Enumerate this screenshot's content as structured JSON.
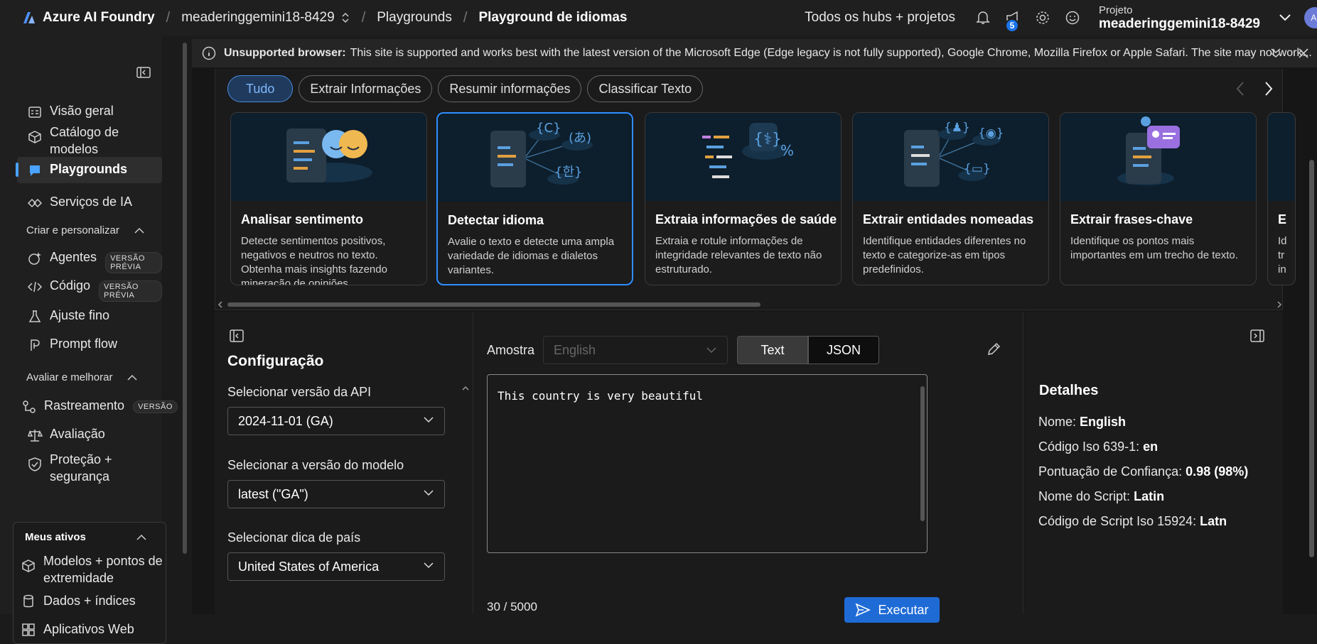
{
  "topbar": {
    "brand": "Azure AI Foundry",
    "resource": "meaderinggemini18-8429",
    "crumb1": "Playgrounds",
    "crumb2": "Playground de idiomas",
    "hubs": "Todos os hubs + projetos",
    "notif_count": "5",
    "project_label": "Projeto",
    "project_name": "meaderinggemini18-8429",
    "avatar": "AI"
  },
  "sidebar": {
    "overview": "Visão geral",
    "catalog": "Catálogo de modelos",
    "playgrounds": "Playgrounds",
    "ai_services": "Serviços de IA",
    "section_create": "Criar e personalizar",
    "agents": "Agentes",
    "agents_tag": "VERSÃO PRÉVIA",
    "code": "Código",
    "code_tag": "VERSÃO PRÉVIA",
    "finetune": "Ajuste fino",
    "promptflow": "Prompt flow",
    "section_eval": "Avaliar e melhorar",
    "tracing": "Rastreamento",
    "tracing_tag": "VERSÃO",
    "evaluation": "Avaliação",
    "protection": "Proteção + segurança",
    "assets_h": "Meus ativos",
    "models": "Modelos + pontos de extremidade",
    "data": "Dados + índices",
    "webapps": "Aplicativos Web"
  },
  "banner": {
    "title": "Unsupported browser:",
    "text": "This site is supported and works best with the latest version of the Microsoft Edge (Edge legacy is not fully supported), Google Chrome, Mozilla Firefox or Apple Safari. The site may not work..."
  },
  "filters": [
    "Tudo",
    "Extrair Informações",
    "Resumir informações",
    "Classificar Texto"
  ],
  "cards": [
    {
      "title": "Analisar sentimento",
      "desc": "Detecte sentimentos positivos, negativos e neutros no texto. Obtenha mais insights fazendo mineração de opiniões."
    },
    {
      "title": "Detectar idioma",
      "desc": "Avalie o texto e detecte uma ampla variedade de idiomas e dialetos variantes."
    },
    {
      "title": "Extraia informações de saúde",
      "desc": "Extraia e rotule informações de integridade relevantes de texto não estruturado."
    },
    {
      "title": "Extrair entidades nomeadas",
      "desc": "Identifique entidades diferentes no texto e categorize-as em tipos predefinidos."
    },
    {
      "title": "Extrair frases-chave",
      "desc": "Identifique os pontos mais importantes em um trecho de texto."
    },
    {
      "title": "E",
      "desc": "Id tr in"
    }
  ],
  "config": {
    "title": "Configuração",
    "api_label": "Selecionar versão da API",
    "api_value": "2024-11-01 (GA)",
    "model_label": "Selecionar a versão do modelo",
    "model_value": "latest (\"GA\")",
    "country_label": "Selecionar dica de país",
    "country_value": "United States of America"
  },
  "center": {
    "sample_label": "Amostra",
    "sample_value": "English",
    "text_tab": "Text",
    "json_tab": "JSON",
    "input_text": "This country is very beautiful",
    "char_count": "30 / 5000",
    "run": "Executar"
  },
  "details": {
    "title": "Detalhes",
    "name_k": "Nome:",
    "name_v": "English",
    "iso_k": "Código Iso 639-1:",
    "iso_v": "en",
    "conf_k": "Pontuação de Confiança:",
    "conf_v": "0.98 (98%)",
    "script_k": "Nome do Script:",
    "script_v": "Latin",
    "scode_k": "Código de Script Iso 15924:",
    "scode_v": "Latn"
  }
}
